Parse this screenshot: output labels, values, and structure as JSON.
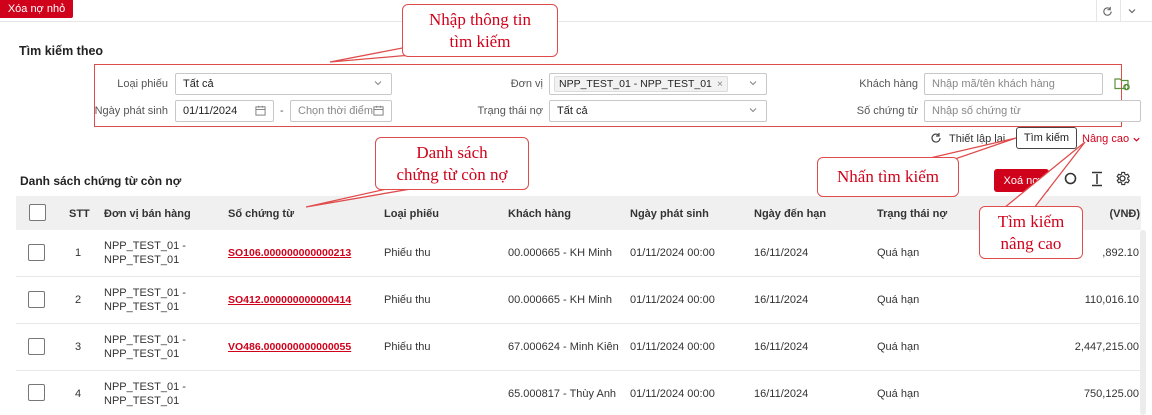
{
  "toolbar": {
    "delete_small_debt_label": "Xóa nợ nhỏ"
  },
  "search": {
    "title": "Tìm kiếm theo",
    "voucher_type": {
      "label": "Loại phiếu",
      "value": "Tất cả"
    },
    "issue_date": {
      "label": "Ngày phát sinh",
      "from_value": "01/11/2024",
      "separator": "-",
      "to_placeholder": "Chọn thời điểm"
    },
    "unit": {
      "label": "Đơn vị",
      "tag": "NPP_TEST_01 - NPP_TEST_01",
      "tag_close": "×"
    },
    "debt_status": {
      "label": "Trạng thái nợ",
      "value": "Tất cả"
    },
    "customer": {
      "label": "Khách hàng",
      "placeholder": "Nhập mã/tên khách hàng"
    },
    "voucher_no": {
      "label": "Số chứng từ",
      "placeholder": "Nhập số chứng từ"
    },
    "reset_label": "Thiết lập lại",
    "search_label": "Tìm kiếm",
    "advanced_label": "Nâng cao"
  },
  "list": {
    "title": "Danh sách chứng từ còn nợ",
    "delete_debt_label": "Xoá nợ",
    "columns": [
      "STT",
      "Đơn vị bán hàng",
      "Số chứng từ",
      "Loại phiếu",
      "Khách hàng",
      "Ngày phát sinh",
      "Ngày đến hạn",
      "Trạng thái nợ",
      "(VNĐ)"
    ],
    "rows": [
      {
        "stt": "1",
        "unit_l1": "NPP_TEST_01 -",
        "unit_l2": "NPP_TEST_01",
        "voucher": "SO106.000000000000213",
        "type": "Phiếu thu",
        "customer": "00.000665 - KH Minh",
        "issued": "01/11/2024 00:00",
        "due": "16/11/2024",
        "status": "Quá hạn",
        "amount": ",892.10"
      },
      {
        "stt": "2",
        "unit_l1": "NPP_TEST_01 -",
        "unit_l2": "NPP_TEST_01",
        "voucher": "SO412.000000000000414",
        "type": "Phiếu thu",
        "customer": "00.000665 - KH Minh",
        "issued": "01/11/2024 00:00",
        "due": "16/11/2024",
        "status": "Quá hạn",
        "amount": "110,016.10"
      },
      {
        "stt": "3",
        "unit_l1": "NPP_TEST_01 -",
        "unit_l2": "NPP_TEST_01",
        "voucher": "VO486.000000000000055",
        "type": "Phiếu thu",
        "customer": "67.000624 - Minh Kiên",
        "issued": "01/11/2024 00:00",
        "due": "16/11/2024",
        "status": "Quá hạn",
        "amount": "2,447,215.00"
      },
      {
        "stt": "4",
        "unit_l1": "NPP_TEST_01 -",
        "unit_l2": "NPP_TEST_01",
        "voucher": "",
        "type": "",
        "customer": "65.000817 - Thùy Anh",
        "issued": "01/11/2024 00:00",
        "due": "16/11/2024",
        "status": "Quá hạn",
        "amount": "750,125.00"
      }
    ]
  },
  "annotations": {
    "search_input": [
      "Nhập thông tin",
      "tìm kiếm"
    ],
    "debt_list": [
      "Danh sách",
      "chứng từ còn nợ"
    ],
    "press_search": "Nhấn tìm kiếm",
    "advanced": [
      "Tìm kiếm",
      "nâng cao"
    ]
  },
  "colors": {
    "accent": "#d0021b",
    "annotation": "#e04c4c",
    "header_bg": "#f0f0f0"
  }
}
